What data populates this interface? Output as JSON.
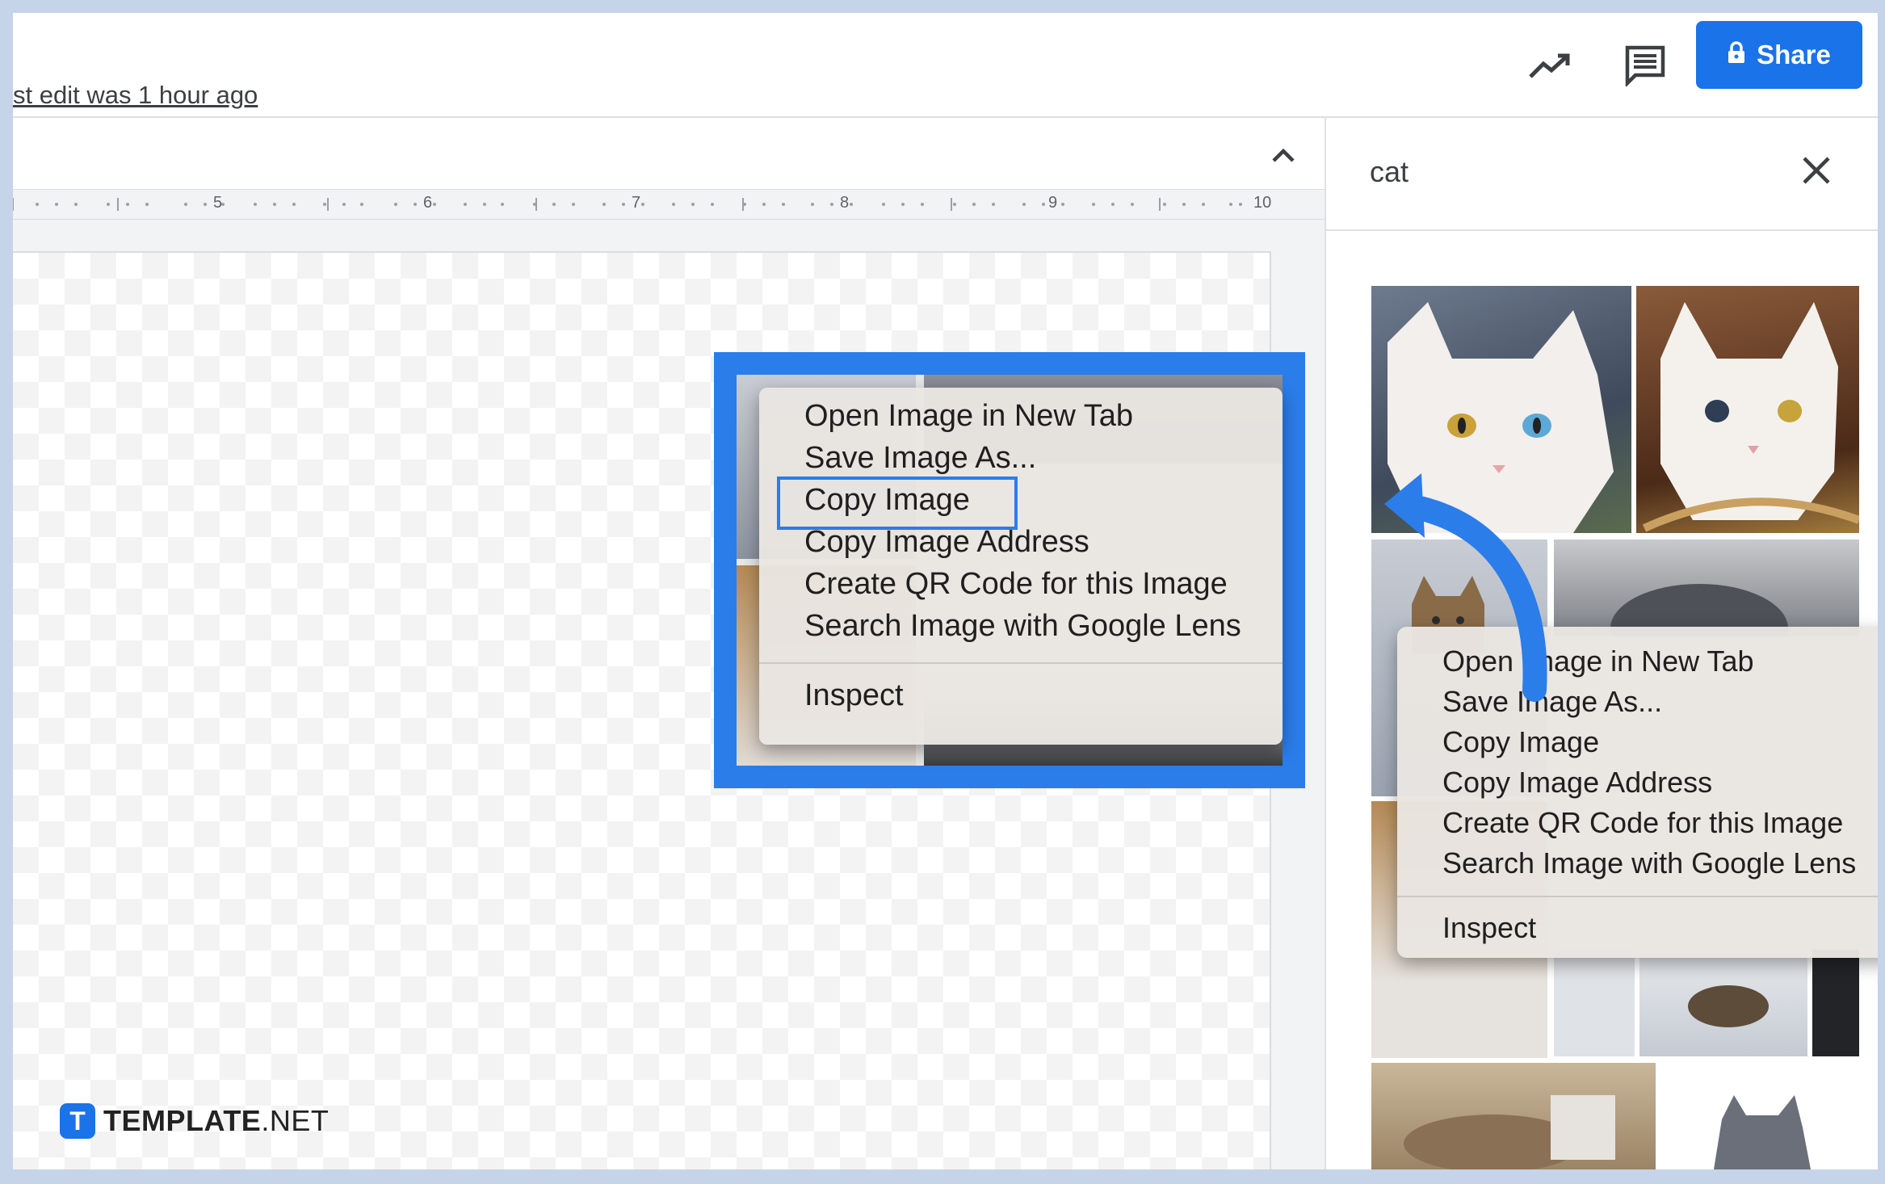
{
  "header": {
    "last_edit": "st edit was 1 hour ago",
    "activity_icon": "trending-up-icon",
    "comments_icon": "comment-icon",
    "share_label": "Share",
    "share_icon": "lock-icon",
    "accent": "#1a73e8"
  },
  "ruler": {
    "labels": [
      "5",
      "6",
      "7",
      "8",
      "9",
      "10"
    ]
  },
  "panel": {
    "search_value": "cat",
    "close_icon": "close-icon"
  },
  "context_menu_main": {
    "items": [
      "Open Image in New Tab",
      "Save Image As...",
      "Copy Image",
      "Copy Image Address",
      "Create QR Code for this Image",
      "Search Image with Google Lens"
    ],
    "bottom_item": "Inspect",
    "highlighted_item": "Copy Image"
  },
  "context_menu_panel": {
    "items": [
      "Open Image in New Tab",
      "Save Image As...",
      "Copy Image",
      "Copy Image Address",
      "Create QR Code for this Image",
      "Search Image with Google Lens"
    ],
    "bottom_item": "Inspect"
  },
  "watermark": {
    "mark": "T",
    "brand": "TEMPLATE",
    "suffix": ".NET"
  },
  "colors": {
    "highlight": "#2b7de9",
    "background": "#c5d4e8"
  }
}
